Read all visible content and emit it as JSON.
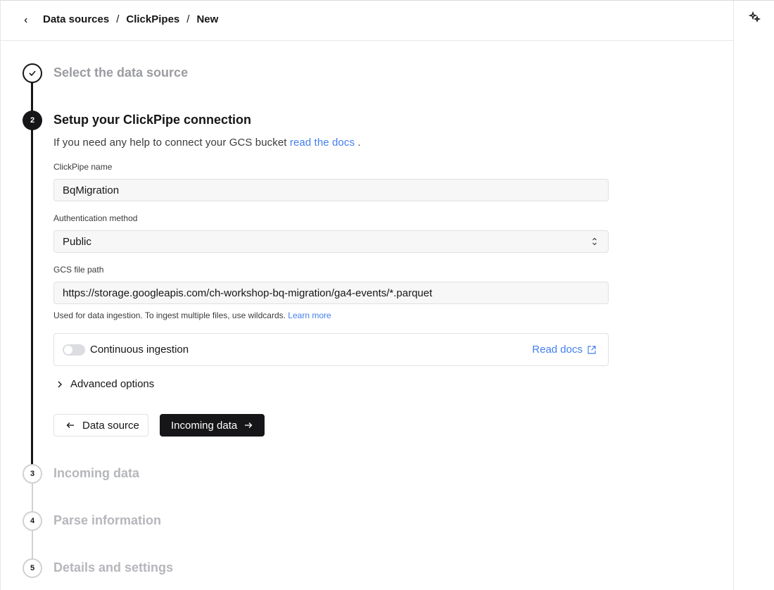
{
  "breadcrumb": {
    "items": [
      "Data sources",
      "ClickPipes",
      "New"
    ],
    "separator": "/"
  },
  "steps": [
    {
      "number": "",
      "title": "Select the data source",
      "status": "done"
    },
    {
      "number": "2",
      "title": "Setup your ClickPipe connection",
      "status": "active"
    },
    {
      "number": "3",
      "title": "Incoming data",
      "status": "todo"
    },
    {
      "number": "4",
      "title": "Parse information",
      "status": "todo"
    },
    {
      "number": "5",
      "title": "Details and settings",
      "status": "todo"
    }
  ],
  "help": {
    "prefix": "If you need any help to connect your GCS bucket",
    "link": "read the docs",
    "suffix": "."
  },
  "form": {
    "name_label": "ClickPipe name",
    "name_value": "BqMigration",
    "auth_label": "Authentication method",
    "auth_value": "Public",
    "path_label": "GCS file path",
    "path_value": "https://storage.googleapis.com/ch-workshop-bq-migration/ga4-events/*.parquet",
    "path_hint": "Used for data ingestion. To ingest multiple files, use wildcards.",
    "path_hint_link": "Learn more",
    "continuous_label": "Continuous ingestion",
    "continuous_enabled": false,
    "read_docs": "Read docs",
    "advanced_label": "Advanced options"
  },
  "buttons": {
    "back_label": "Data source",
    "next_label": "Incoming data"
  },
  "colors": {
    "accent": "#437eef",
    "dark": "#161517",
    "border": "#dfe1e4"
  }
}
